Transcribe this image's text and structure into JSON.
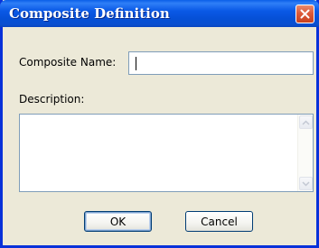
{
  "window": {
    "title": "Composite Definition",
    "close_icon": "close-x-icon"
  },
  "form": {
    "name_label": "Composite Name:",
    "name_value": "",
    "description_label": "Description:",
    "description_value": ""
  },
  "buttons": {
    "ok_label": "OK",
    "cancel_label": "Cancel"
  },
  "colors": {
    "titlebar": "#0a59e6",
    "window_border": "#0831d9",
    "dialog_background": "#ece9d8",
    "close_button": "#dd5a3a",
    "input_border": "#7f9db9"
  }
}
